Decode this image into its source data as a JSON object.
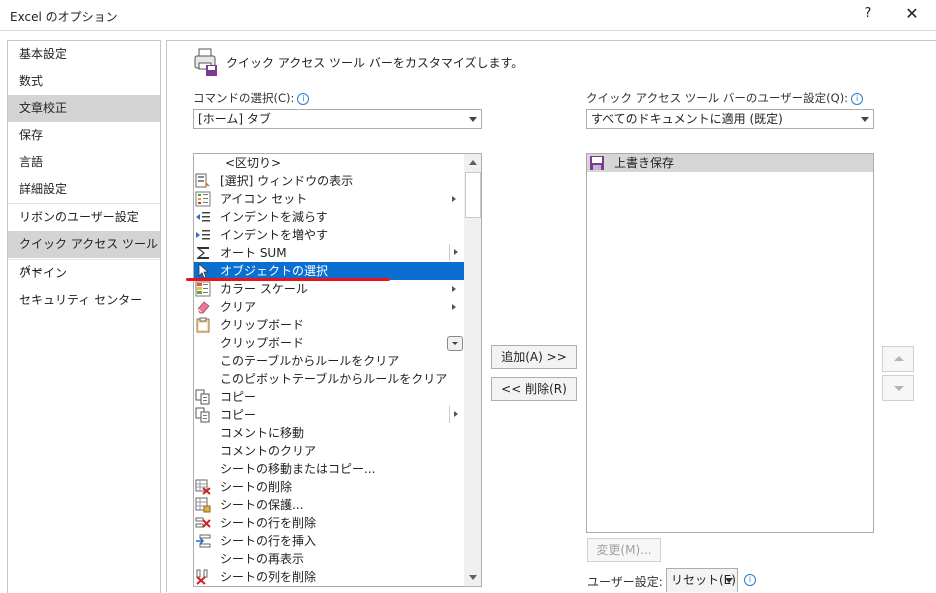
{
  "window": {
    "title": "Excel のオプション",
    "help": "?",
    "close": "✕"
  },
  "sidebar": {
    "items": [
      {
        "label": "基本設定"
      },
      {
        "label": "数式"
      },
      {
        "label": "文章校正"
      },
      {
        "label": "保存"
      },
      {
        "label": "言語"
      },
      {
        "label": "詳細設定"
      },
      {
        "label": "リボンのユーザー設定"
      },
      {
        "label": "クイック アクセス ツール バー"
      },
      {
        "label": "アドイン"
      },
      {
        "label": "セキュリティ センター"
      }
    ],
    "selected": "クイック アクセス ツール バー"
  },
  "header": {
    "text": "クイック アクセス ツール バーをカスタマイズします。"
  },
  "commands": {
    "label": "コマンドの選択(C):",
    "combo_value": "[ホーム] タブ",
    "items": [
      {
        "label": "<区切り>",
        "icon": "none"
      },
      {
        "label": "[選択] ウィンドウの表示",
        "icon": "selection-pane-icon"
      },
      {
        "label": "アイコン セット",
        "icon": "icon-set-icon"
      },
      {
        "label": "インデントを減らす",
        "icon": "decrease-indent-icon"
      },
      {
        "label": "インデントを増やす",
        "icon": "increase-indent-icon"
      },
      {
        "label": "オート SUM",
        "icon": "sum-icon"
      },
      {
        "label": "オブジェクトの選択",
        "icon": "cursor-icon"
      },
      {
        "label": "カラー スケール",
        "icon": "color-scale-icon"
      },
      {
        "label": "クリア",
        "icon": "eraser-icon"
      },
      {
        "label": "クリップボード",
        "icon": "clipboard-icon"
      },
      {
        "label": "クリップボード",
        "icon": "none"
      },
      {
        "label": "このテーブルからルールをクリア",
        "icon": "none"
      },
      {
        "label": "このピボットテーブルからルールをクリア",
        "icon": "none"
      },
      {
        "label": "コピー",
        "icon": "copy-icon"
      },
      {
        "label": "コピー",
        "icon": "copy-icon"
      },
      {
        "label": "コメントに移動",
        "icon": "none"
      },
      {
        "label": "コメントのクリア",
        "icon": "none"
      },
      {
        "label": "シートの移動またはコピー...",
        "icon": "none"
      },
      {
        "label": "シートの削除",
        "icon": "delete-sheet-icon"
      },
      {
        "label": "シートの保護...",
        "icon": "protect-sheet-icon"
      },
      {
        "label": "シートの行を削除",
        "icon": "delete-rows-icon"
      },
      {
        "label": "シートの行を挿入",
        "icon": "insert-rows-icon"
      },
      {
        "label": "シートの再表示",
        "icon": "none"
      },
      {
        "label": "シートの列を削除",
        "icon": "delete-columns-icon"
      }
    ],
    "selected_index": 6
  },
  "buttons": {
    "add": "追加(A) >>",
    "remove": "<< 削除(R)",
    "modify": "変更(M)...",
    "reset": "リセット(E)"
  },
  "custom": {
    "label": "クイック アクセス ツール バーのユーザー設定(Q):",
    "combo_value": "すべてのドキュメントに適用 (既定)",
    "items": [
      {
        "label": "上書き保存",
        "icon": "save-icon"
      }
    ]
  },
  "footer": {
    "user_settings_label": "ユーザー設定:"
  },
  "colors": {
    "selection": "#0a6fd1",
    "annotation_line": "#e8141a",
    "nav_selected": "#d4d4d4"
  }
}
